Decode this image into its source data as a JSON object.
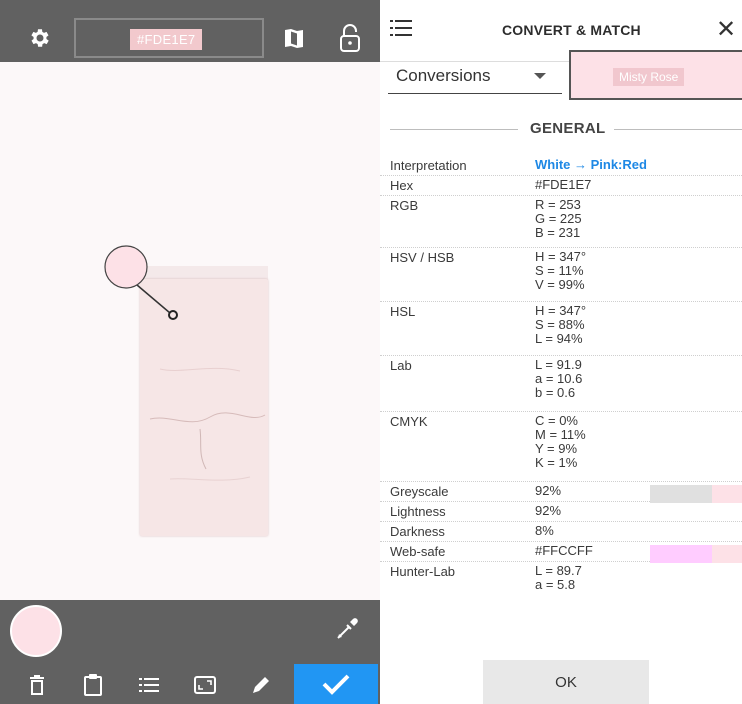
{
  "left_toolbar": {
    "hex_chip": "#FDE1E7",
    "color": "#fde1e7"
  },
  "icons": {
    "gear": "gear-icon",
    "map": "map-icon",
    "lock": "lock-icon",
    "picker": "eyedropper-icon",
    "delete": "trash-icon",
    "paste": "clipboard-icon",
    "list": "list-icon",
    "crop": "crop-icon",
    "edit": "pencil-icon",
    "confirm": "checkmark-icon",
    "menu": "menu-icon",
    "close": "close-icon"
  },
  "right_panel": {
    "title": "CONVERT & MATCH",
    "close_glyph": "✕",
    "conversions_label": "Conversions",
    "match_name": "Misty Rose",
    "section": "GENERAL",
    "ok_label": "OK",
    "rows": [
      {
        "label": "Interpretation",
        "value": "White → Pink:Red"
      },
      {
        "label": "Hex",
        "value": "#FDE1E7"
      },
      {
        "label": "RGB",
        "value": "R = 253\nG = 225\nB = 231"
      },
      {
        "label": "HSV / HSB",
        "value": "H = 347°\nS = 11%\nV = 99%"
      },
      {
        "label": "HSL",
        "value": "H = 347°\nS = 88%\nL = 94%"
      },
      {
        "label": "Lab",
        "value": "L = 91.9\na = 10.6\nb = 0.6"
      },
      {
        "label": "CMYK",
        "value": "C = 0%\nM = 11%\nY = 9%\nK = 1%"
      },
      {
        "label": "Greyscale",
        "value": "92%"
      },
      {
        "label": "Lightness",
        "value": "92%"
      },
      {
        "label": "Darkness",
        "value": "8%"
      },
      {
        "label": "Web-safe",
        "value": "#FFCCFF"
      },
      {
        "label": "Hunter-Lab",
        "value": "L = 89.7\na = 5.8"
      }
    ]
  },
  "colors": {
    "bar": "#616161",
    "accent": "#2196f3",
    "link": "#1e88e5",
    "sample": "#fde1e7",
    "greyscale_swatch": "#e0e0e0",
    "websafe_swatch": "#ffccff"
  }
}
